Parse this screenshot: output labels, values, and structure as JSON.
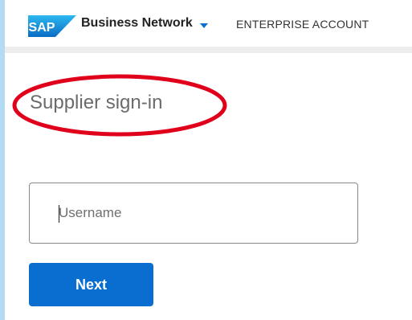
{
  "header": {
    "logo_text": "SAP",
    "product_label": "Business Network",
    "account_link": "ENTERPRISE ACCOUNT"
  },
  "main": {
    "title": "Supplier sign-in",
    "username": {
      "value": "",
      "placeholder": "Username"
    },
    "next_label": "Next"
  },
  "colors": {
    "accent": "#0a6ed1",
    "annotation": "#e0001b",
    "logo_gradient_top": "#2db8f0",
    "logo_gradient_bottom": "#0a6cc4"
  }
}
